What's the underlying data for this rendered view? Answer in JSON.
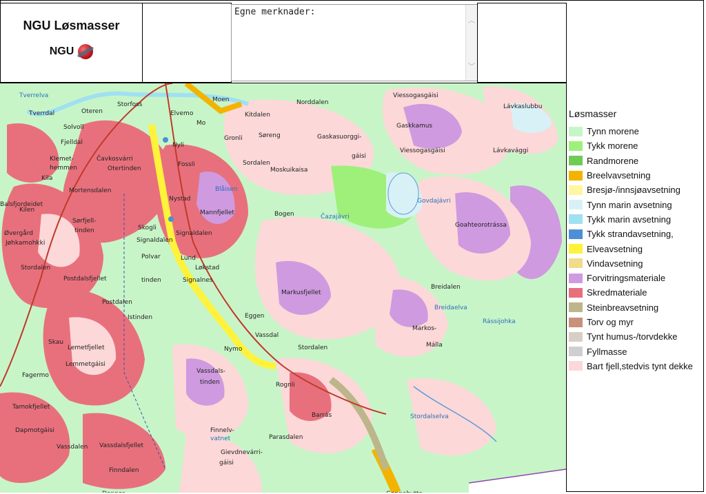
{
  "header": {
    "title": "NGU Løsmasser",
    "logo_text": "NGU",
    "notes_label": "Egne merknader:"
  },
  "legend": {
    "title": "Løsmasser",
    "items": [
      {
        "label": "Tynn morene",
        "color": "#c8f5c8"
      },
      {
        "label": "Tykk morene",
        "color": "#9ef07a"
      },
      {
        "label": "Randmorene",
        "color": "#6ecb55"
      },
      {
        "label": "Breelvavsetning",
        "color": "#f2b400"
      },
      {
        "label": "Bresjø-/innsjøavsetning",
        "color": "#fff6a0"
      },
      {
        "label": "Tynn marin avsetning",
        "color": "#d8f1f6"
      },
      {
        "label": "Tykk marin avsetning",
        "color": "#9fe0f2"
      },
      {
        "label": "Tykk strandavsetning,",
        "color": "#4d8fd6"
      },
      {
        "label": "Elveavsetning",
        "color": "#fff23a"
      },
      {
        "label": "Vindavsetning",
        "color": "#f0dc8a"
      },
      {
        "label": "Forvitringsmateriale",
        "color": "#cf9ae0"
      },
      {
        "label": "Skredmateriale",
        "color": "#e8707c"
      },
      {
        "label": "Steinbreavsetning",
        "color": "#bcb68a"
      },
      {
        "label": "Torv og myr",
        "color": "#c9907a"
      },
      {
        "label": "Tynt humus-/torvdekke",
        "color": "#d8cfc4"
      },
      {
        "label": "Fyllmasse",
        "color": "#cfcfcf"
      },
      {
        "label": "Bart fjell,stedvis tynt dekke",
        "color": "#fcd8d8"
      }
    ]
  },
  "map_labels": [
    "Tverrelva",
    "Tverrdal",
    "Oteren",
    "Storfoss",
    "Moen",
    "Norddalen",
    "Viessogasgáisi",
    "Lávkaslubbu",
    "Solvoll",
    "Elvemo",
    "Mo",
    "Kitdalen",
    "Gaskkamus",
    "Fjelldal",
    "Gronli",
    "Søreng",
    "Gaskasuorggi-",
    "gáisi",
    "Viessogasgáisi",
    "Lávkavággi",
    "Klemet-",
    "hemmen",
    "Čavkosvárri",
    "Otertinden",
    "Nyli",
    "Fossli",
    "Moskuikaisa",
    "Kila",
    "Mortensdalen",
    "Blåisen",
    "Sordalen",
    "Balsfjordeidet",
    "Kilen",
    "Nystad",
    "Mannfjellet",
    "Bogen",
    "Čazajávri",
    "Govdajávri",
    "Goahteorotrássa",
    "Sørfjell-",
    "tinden",
    "Øvergård",
    "Jøhkamohkki",
    "Skogli",
    "Signaldalen",
    "Signaldalen",
    "Polvar",
    "Lund",
    "Løkstad",
    "Stordalen",
    "Postdalsfjellet",
    "tinden",
    "Signalnes",
    "Markusfjellet",
    "Breidalen",
    "Postdalen",
    "Istinden",
    "Eggen",
    "Markos-",
    "Vassdal",
    "Nymo",
    "Breidaelva",
    "Rássijohka",
    "Skau",
    "Lemetfjellet",
    "Lemmetgáisi",
    "Stordalen",
    "Málla",
    "Fagermo",
    "Vassdals-",
    "tinden",
    "Rognli",
    "Tamokfjellet",
    "Dapmotgáisi",
    "Barrás",
    "Stordalselva",
    "Finnelv-",
    "vatnet",
    "Vassdalen",
    "Vassdalsfjellet",
    "Parasdalen",
    "Finndalen",
    "Gievdnevárri-",
    "gáisi",
    "Gappohytta",
    "Doppar"
  ]
}
